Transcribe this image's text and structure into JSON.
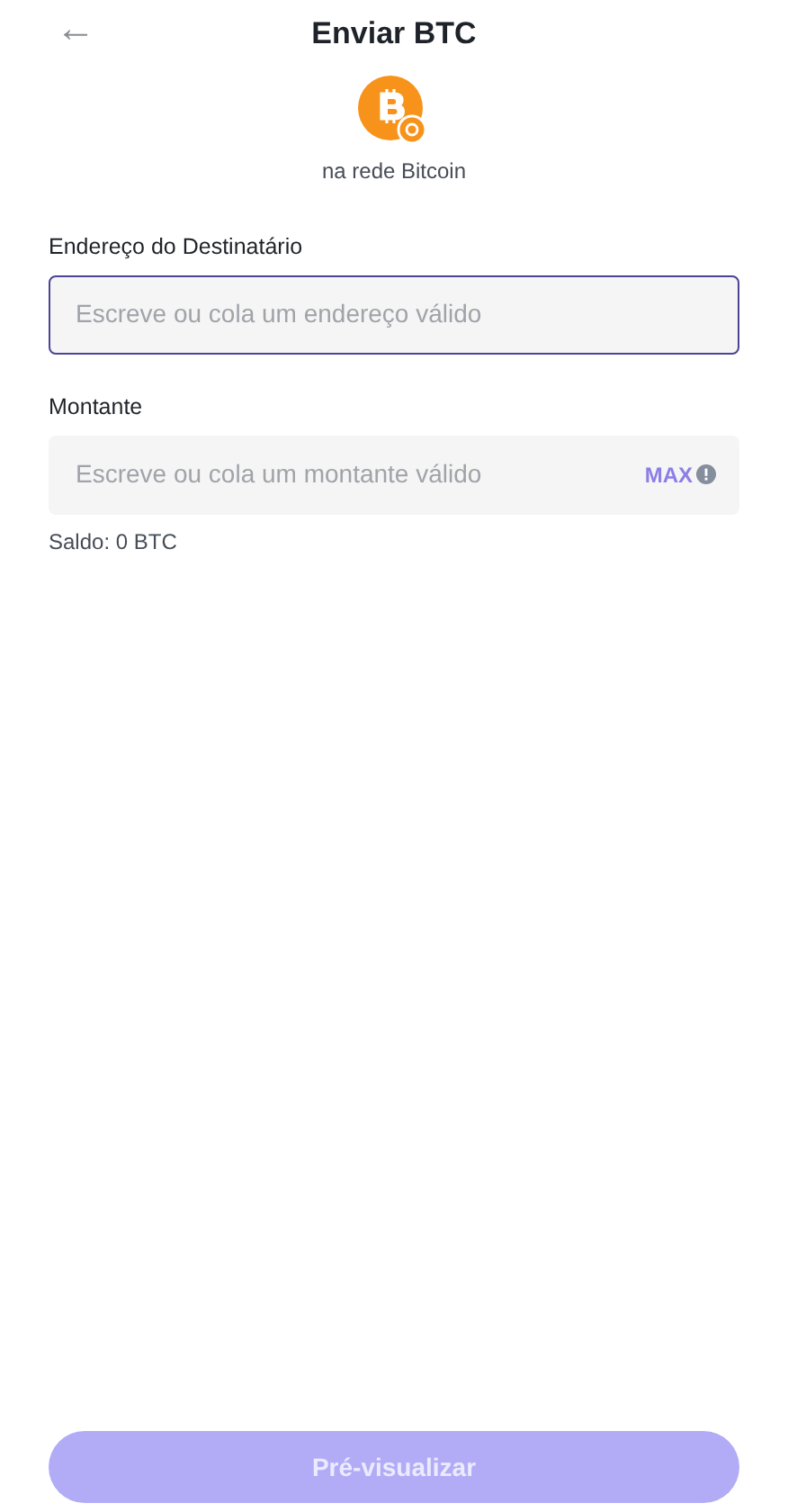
{
  "header": {
    "back": "←",
    "title": "Enviar BTC"
  },
  "network": {
    "label": "na rede Bitcoin"
  },
  "fields": [
    {
      "label": "Endereço do Destinatário",
      "placeholder": "Escreve ou cola um endereço válido",
      "focused": true
    },
    {
      "label": "Montante",
      "placeholder": "Escreve ou cola um montante válido",
      "focused": false,
      "action": "MAX"
    }
  ],
  "balance": "Saldo: 0 BTC",
  "submit": {
    "label": "Pré-visualizar",
    "disabled": true
  }
}
